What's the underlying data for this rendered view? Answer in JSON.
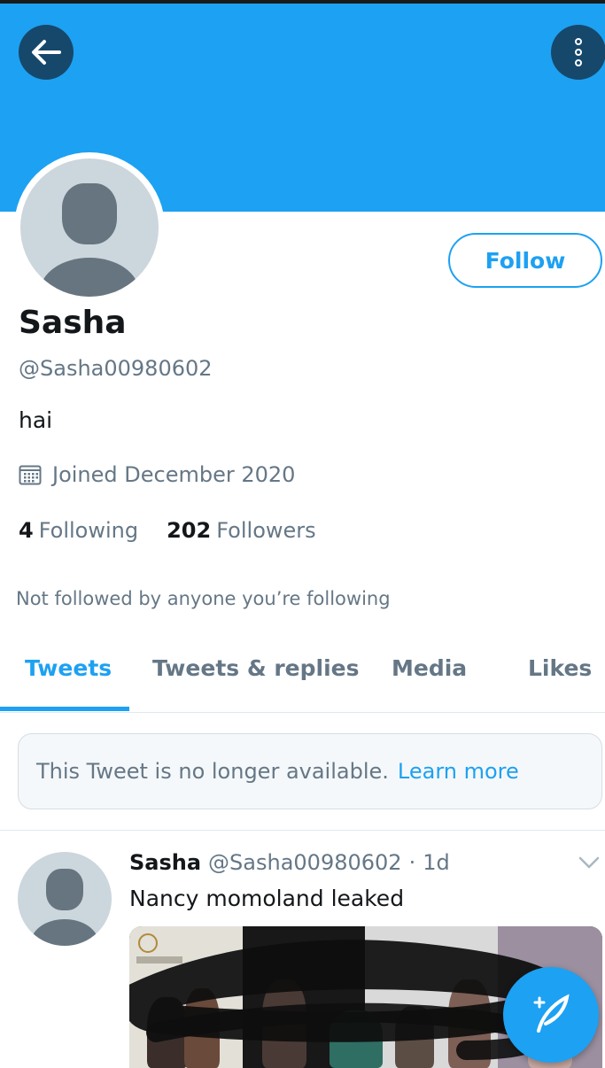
{
  "header": {
    "back_icon": "arrow-left-icon",
    "more_icon": "more-vertical-icon",
    "banner_color": "#1da1f2"
  },
  "profile": {
    "follow_label": "Follow",
    "name": "Sasha",
    "handle": "@Sasha00980602",
    "bio": "hai",
    "joined": "Joined December 2020",
    "following_count": "4",
    "following_label": "Following",
    "followers_count": "202",
    "followers_label": "Followers",
    "not_followed_text": "Not followed by anyone you’re following"
  },
  "tabs": [
    {
      "label": "Tweets",
      "active": true
    },
    {
      "label": "Tweets & replies",
      "active": false
    },
    {
      "label": "Media",
      "active": false
    },
    {
      "label": "Likes",
      "active": false
    }
  ],
  "unavailable_notice": {
    "text": "This Tweet is no longer available.",
    "link": "Learn more"
  },
  "tweet": {
    "name": "Sasha",
    "handle": "@Sasha00980602",
    "separator": "·",
    "time": "1d",
    "text": "Nancy momoland leaked"
  },
  "colors": {
    "accent": "#1da1f2",
    "secondary_text": "#657786",
    "primary_text": "#14171a"
  },
  "fab": {
    "icon": "compose-tweet-icon"
  }
}
